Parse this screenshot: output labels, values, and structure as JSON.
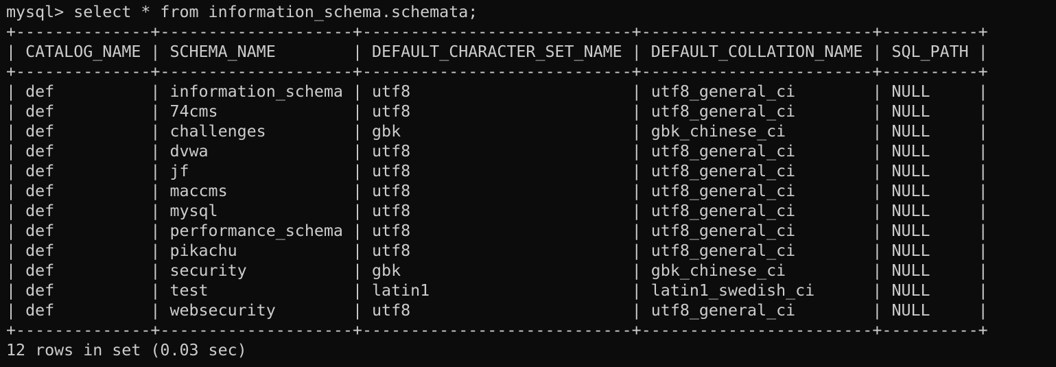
{
  "terminal": {
    "prompt": "mysql> ",
    "command": "select * from information_schema.schemata;",
    "table": {
      "columns": [
        "CATALOG_NAME",
        "SCHEMA_NAME",
        "DEFAULT_CHARACTER_SET_NAME",
        "DEFAULT_COLLATION_NAME",
        "SQL_PATH"
      ],
      "rows": [
        [
          "def",
          "information_schema",
          "utf8",
          "utf8_general_ci",
          "NULL"
        ],
        [
          "def",
          "74cms",
          "utf8",
          "utf8_general_ci",
          "NULL"
        ],
        [
          "def",
          "challenges",
          "gbk",
          "gbk_chinese_ci",
          "NULL"
        ],
        [
          "def",
          "dvwa",
          "utf8",
          "utf8_general_ci",
          "NULL"
        ],
        [
          "def",
          "jf",
          "utf8",
          "utf8_general_ci",
          "NULL"
        ],
        [
          "def",
          "maccms",
          "utf8",
          "utf8_general_ci",
          "NULL"
        ],
        [
          "def",
          "mysql",
          "utf8",
          "utf8_general_ci",
          "NULL"
        ],
        [
          "def",
          "performance_schema",
          "utf8",
          "utf8_general_ci",
          "NULL"
        ],
        [
          "def",
          "pikachu",
          "utf8",
          "utf8_general_ci",
          "NULL"
        ],
        [
          "def",
          "security",
          "gbk",
          "gbk_chinese_ci",
          "NULL"
        ],
        [
          "def",
          "test",
          "latin1",
          "latin1_swedish_ci",
          "NULL"
        ],
        [
          "def",
          "websecurity",
          "utf8",
          "utf8_general_ci",
          "NULL"
        ]
      ]
    },
    "summary": "12 rows in set (0.03 sec)",
    "colors": {
      "background": "#0c0c0c",
      "foreground": "#cccccc"
    }
  }
}
